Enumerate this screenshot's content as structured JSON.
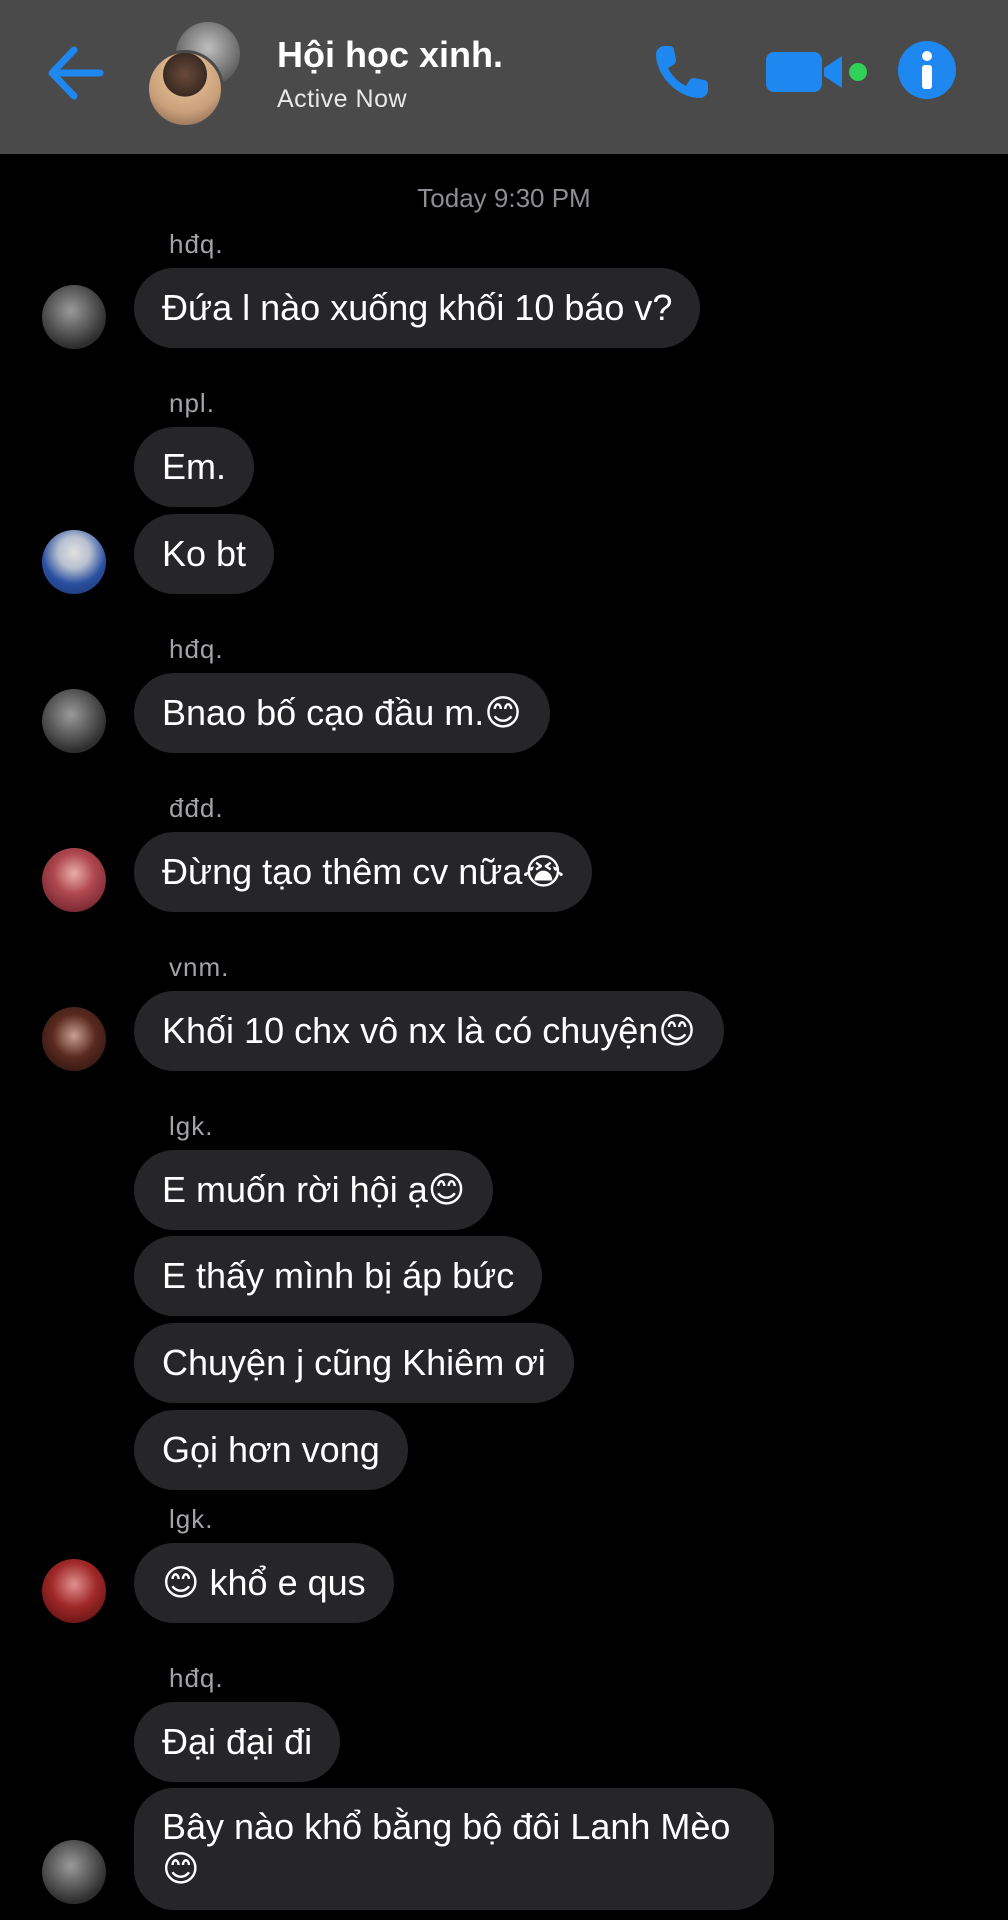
{
  "header": {
    "title": "Hội học xinh.",
    "status": "Active Now",
    "accent": "#0a84ff",
    "online_dot": "#30d158",
    "icons": [
      "back-arrow-icon",
      "phone-icon",
      "video-camera-icon",
      "info-icon"
    ]
  },
  "timestamp": "Today 9:30 PM",
  "senders": [
    "hđq.",
    "npl.",
    "hđq.",
    "đđd.",
    "vnm.",
    "lgk.",
    "lgk.",
    "hđq."
  ],
  "messages": [
    "Đứa l nào xuống khối 10 báo v?",
    "Em.",
    "Ko bt",
    "Bnao bố cạo đầu m.😊",
    "Đừng tạo thêm cv nữa😭",
    "Khối 10 chx vô nx là có chuyện😊",
    "E muốn rời hội ạ😊",
    "E thấy mình bị áp bức",
    "Chuyện j cũng Khiêm ơi",
    "Gọi hơn vong",
    "😊 khổ e qus",
    "Đại đại đi",
    "Bây nào khổ bằng bộ đôi Lanh Mèo 😊"
  ]
}
